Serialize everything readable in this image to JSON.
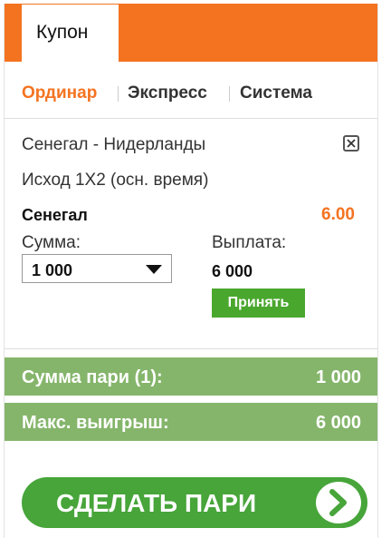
{
  "coupon": {
    "tab_label": "Купон"
  },
  "bet_types": [
    {
      "label": "Ординар",
      "active": true
    },
    {
      "label": "Экспресс",
      "active": false
    },
    {
      "label": "Система",
      "active": false
    }
  ],
  "bet": {
    "event": "Сенегал - Нидерланды",
    "market": "Исход 1X2 (осн. время)",
    "selection": "Сенегал",
    "odds": "6.00",
    "stake_label": "Сумма:",
    "stake_value": "1 000",
    "payout_label": "Выплата:",
    "payout_value": "6 000",
    "accept_label": "Принять"
  },
  "summary": {
    "total_label": "Сумма пари (1):",
    "total_value": "1 000",
    "max_win_label": "Макс. выигрыш:",
    "max_win_value": "6 000"
  },
  "place_bet_label": "СДЕЛАТЬ ПАРИ",
  "colors": {
    "accent": "#f47321",
    "green": "#47a53a",
    "summary_bg": "#85b56b"
  },
  "icons": {
    "close": "close-icon",
    "arrow": "chevron-right-icon",
    "dropdown": "caret-down-icon"
  }
}
